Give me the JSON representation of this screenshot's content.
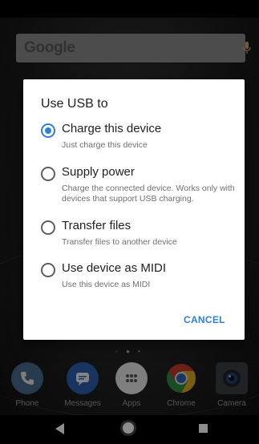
{
  "search": {
    "logo_text": "Google"
  },
  "dialog": {
    "title": "Use USB to",
    "options": [
      {
        "label": "Charge this device",
        "description": "Just charge this device",
        "selected": true
      },
      {
        "label": "Supply power",
        "description": "Charge the connected device. Works only with devices that support USB charging.",
        "selected": false
      },
      {
        "label": "Transfer files",
        "description": "Transfer files to another device",
        "selected": false
      },
      {
        "label": "Use device as MIDI",
        "description": "Use this device as MIDI",
        "selected": false
      }
    ],
    "cancel_label": "CANCEL"
  },
  "dock": {
    "page_indicator": "◦ ● •",
    "apps": [
      {
        "label": "Phone",
        "icon": "phone-icon",
        "color": "#4a6c8f"
      },
      {
        "label": "Messages",
        "icon": "messages-icon",
        "color": "#2c5fae"
      },
      {
        "label": "Apps",
        "icon": "apps-grid-icon",
        "color": "#e8e8e8"
      },
      {
        "label": "Chrome",
        "icon": "chrome-icon",
        "color": "#c1392b"
      },
      {
        "label": "Camera",
        "icon": "camera-icon",
        "color": "#3b3f44"
      }
    ]
  },
  "colors": {
    "accent": "#2f7ed8",
    "dialog_bg": "#ffffff",
    "scrim": "rgba(0,0,0,0.45)"
  }
}
